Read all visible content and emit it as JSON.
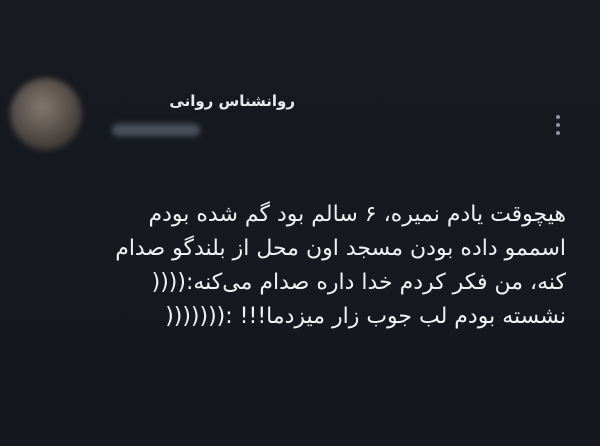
{
  "tweet": {
    "display_name": "روانشناس روانی",
    "handle": "",
    "lines": [
      "هیچوقت یادم نمیره، ۶ سالم بود گم شده بودم",
      "اسممو داده بودن مسجد اون محل از بلندگو صدام",
      "کنه، من فکر کردم خدا داره صدام می‌کنه:((((",
      "نشسته بودم لب جوب زار میزدما!!! :((((((("
    ]
  },
  "icons": {
    "more": "more-vertical-icon"
  },
  "colors": {
    "background": "#16181e",
    "text": "#f0f1f3",
    "icon": "#8b96a2"
  }
}
